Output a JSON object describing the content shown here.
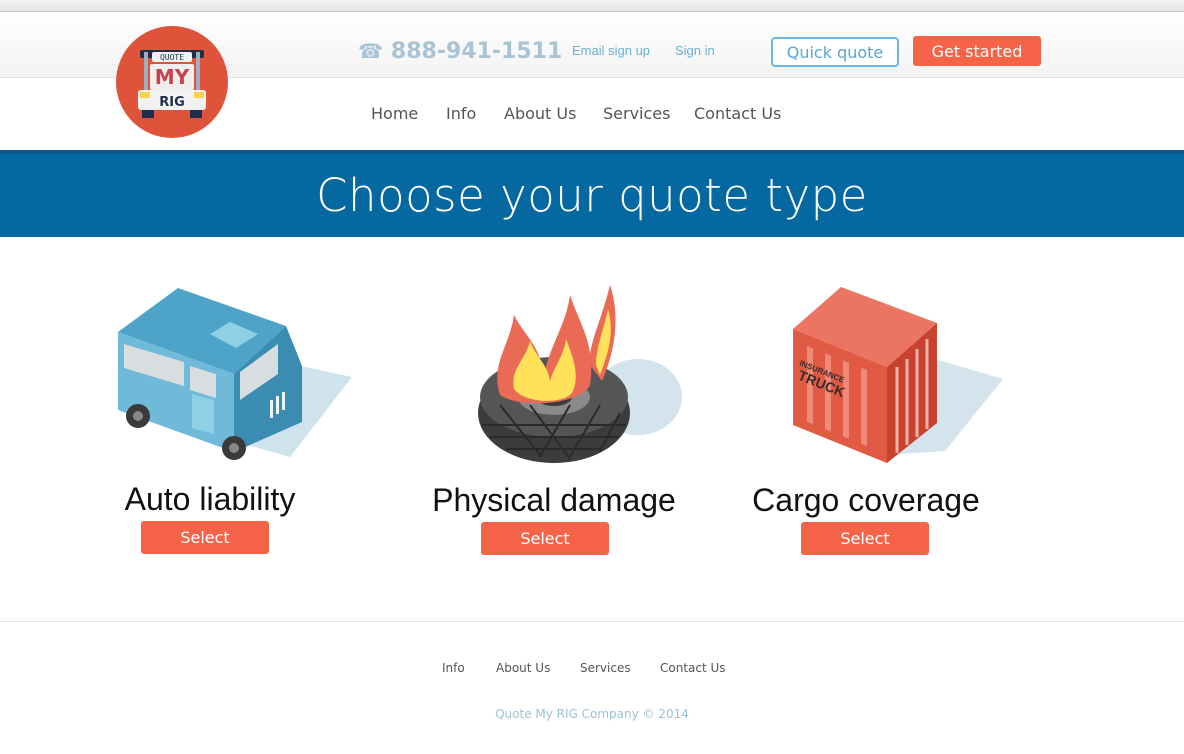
{
  "header": {
    "phone": "888-941-1511",
    "phone_icon": "phone-icon",
    "email_signup": "Email sign up",
    "sign_in": "Sign in",
    "quick_quote": "Quick quote",
    "get_started": "Get started"
  },
  "logo": {
    "top_word": "QUOTE",
    "middle_word": "MY",
    "bottom_word": "RIG"
  },
  "nav": {
    "items": [
      {
        "label": "Home"
      },
      {
        "label": "Info"
      },
      {
        "label": "About Us"
      },
      {
        "label": "Services"
      },
      {
        "label": "Contact Us"
      }
    ]
  },
  "banner": {
    "title": "Choose your quote type"
  },
  "cards": [
    {
      "title": "Auto liability",
      "button": "Select",
      "icon": "truck-icon"
    },
    {
      "title": "Physical damage",
      "button": "Select",
      "icon": "burning-tire-icon"
    },
    {
      "title": "Cargo coverage",
      "button": "Select",
      "icon": "cargo-container-icon",
      "container_text": [
        "INSURANCE",
        "TRUCK"
      ]
    }
  ],
  "footer": {
    "links": [
      {
        "label": "Info"
      },
      {
        "label": "About Us"
      },
      {
        "label": "Services"
      },
      {
        "label": "Contact Us"
      }
    ],
    "copyright": "Quote My RIG Company © 2014"
  },
  "colors": {
    "brand_blue": "#0568a0",
    "accent_orange": "#f56448",
    "logo_red": "#e0533b",
    "link_blue": "#6ab0d3"
  }
}
